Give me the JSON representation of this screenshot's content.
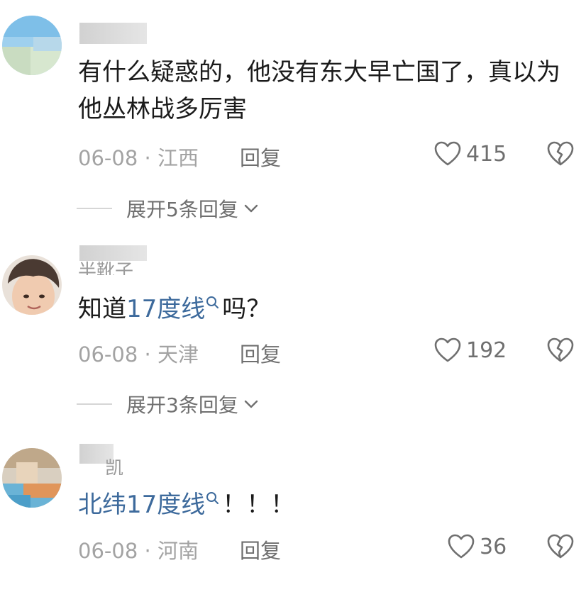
{
  "comments": [
    {
      "username": "",
      "text": "有什么疑惑的，他没有东大早亡国了，真以为他丛林战多厉害",
      "date": "06-08",
      "location": "江西",
      "reply_label": "回复",
      "likes": "415",
      "expand_label": "展开5条回复"
    },
    {
      "username": "半靴子",
      "text_before": "知道",
      "link_text": "17度线",
      "text_after": "吗？",
      "date": "06-08",
      "location": "天津",
      "reply_label": "回复",
      "likes": "192",
      "expand_label": "展开3条回复"
    },
    {
      "username": "凯",
      "link_text": "北纬17度线",
      "text_after": "！！！",
      "date": "06-08",
      "location": "河南",
      "reply_label": "回复",
      "likes": "36"
    }
  ],
  "colors": {
    "text": "#1b1b1b",
    "meta": "#a3a3a3",
    "link": "#3d6a9c",
    "icon": "#6f6f6f"
  },
  "icons": {
    "like": "heart-outline-icon",
    "dislike": "broken-heart-icon",
    "expand": "chevron-down-icon",
    "search": "search-mark-icon"
  }
}
